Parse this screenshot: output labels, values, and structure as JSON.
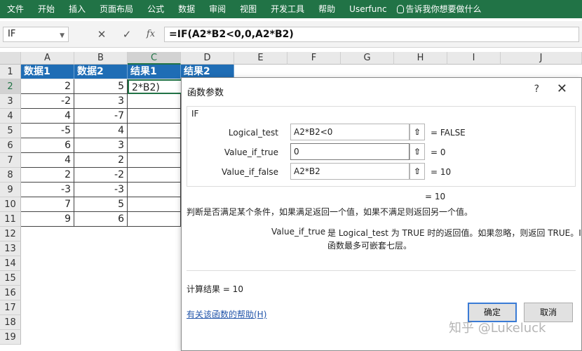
{
  "ribbon": {
    "tabs": [
      "文件",
      "开始",
      "插入",
      "页面布局",
      "公式",
      "数据",
      "审阅",
      "视图",
      "开发工具",
      "帮助",
      "Userfunc"
    ],
    "tell_me": "告诉我你想要做什么",
    "color": "#217346"
  },
  "formula_bar": {
    "name_box": "IF",
    "cancel_icon": "✕",
    "enter_icon": "✓",
    "fx_icon": "fx",
    "formula": "=IF(A2*B2<0,0,A2*B2)"
  },
  "grid": {
    "columns": [
      "A",
      "B",
      "C",
      "D",
      "E",
      "F",
      "G",
      "H",
      "I",
      "J"
    ],
    "selected_column": "C",
    "rows": [
      "1",
      "2",
      "3",
      "4",
      "5",
      "6",
      "7",
      "8",
      "9",
      "10",
      "11",
      "12",
      "13",
      "14",
      "15",
      "16",
      "17",
      "18",
      "19"
    ],
    "selected_row": "2",
    "headers": [
      "数据1",
      "数据2",
      "结果1",
      "结果2"
    ],
    "data1": [
      "2",
      "-2",
      "4",
      "-5",
      "6",
      "4",
      "2",
      "-3",
      "7",
      "9"
    ],
    "data2": [
      "5",
      "3",
      "-7",
      "4",
      "3",
      "2",
      "-2",
      "-3",
      "5",
      "6"
    ],
    "active_cell_text": "2*B2)"
  },
  "dialog": {
    "title": "函数参数",
    "help_icon": "?",
    "close_icon": "✕",
    "function_name": "IF",
    "args": [
      {
        "label": "Logical_test",
        "value": "A2*B2<0",
        "result": "=  FALSE"
      },
      {
        "label": "Value_if_true",
        "value": "0",
        "result": "=  0"
      },
      {
        "label": "Value_if_false",
        "value": "A2*B2",
        "result": "=  10"
      }
    ],
    "collapse_icon": "⇧",
    "overall_result": "=  10",
    "description": "判断是否满足某个条件，如果满足返回一个值，如果不满足则返回另一个值。",
    "arg_help_name": "Value_if_true",
    "arg_help_line1": "是 Logical_test 为 TRUE 时的返回值。如果忽略，则返回 TRUE。IF",
    "arg_help_line2": "函数最多可嵌套七层。",
    "calc_result": "计算结果 =   10",
    "help_link": "有关该函数的帮助(H)",
    "ok": "确定",
    "cancel": "取消"
  },
  "watermark": "知乎 @Lukeluck"
}
